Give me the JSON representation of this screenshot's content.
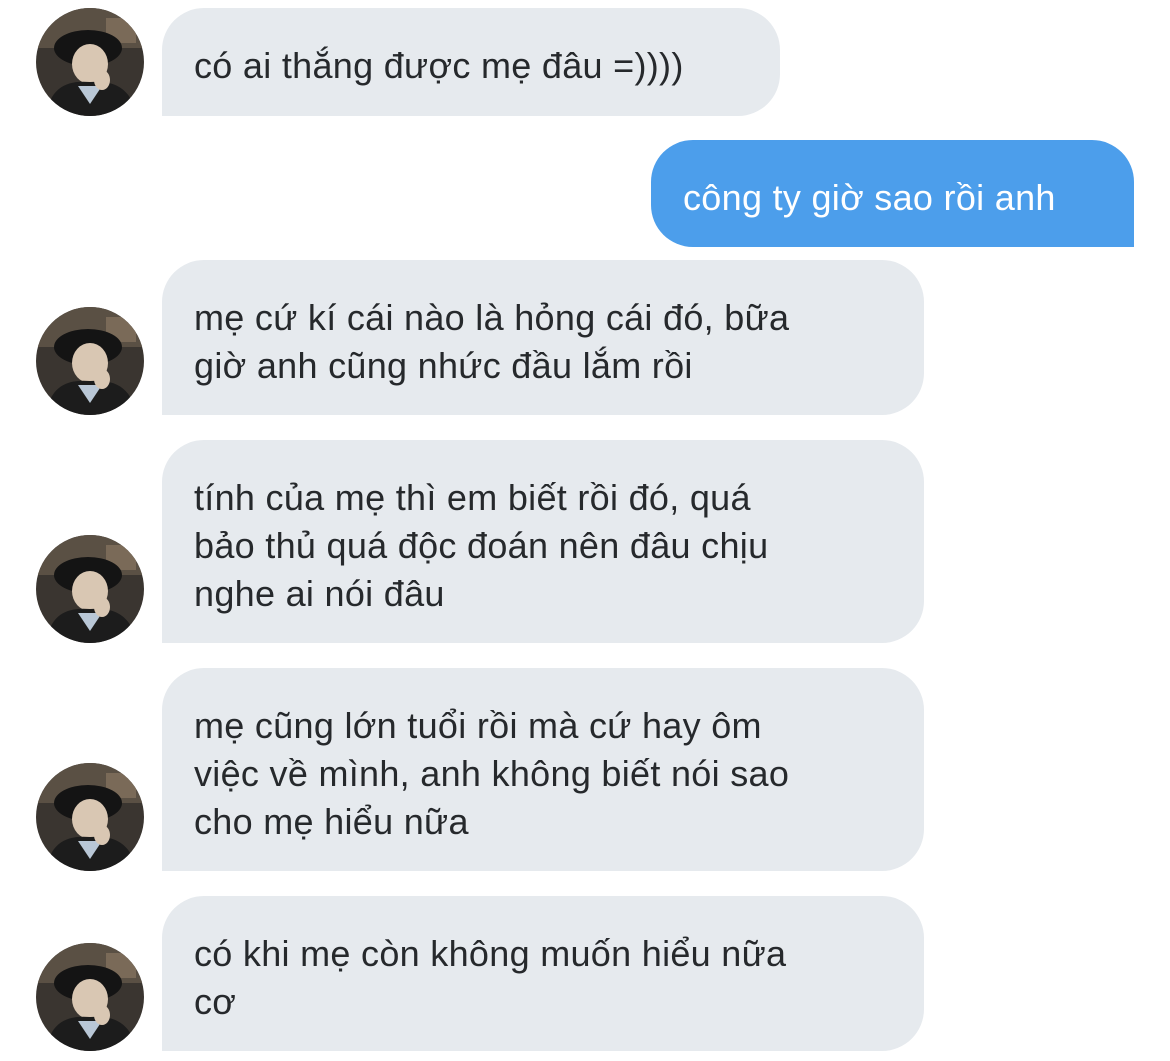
{
  "colors": {
    "incoming_bubble": "#e6eaee",
    "outgoing_bubble": "#4c9eeb",
    "incoming_text": "#26292c",
    "outgoing_text": "#ffffff"
  },
  "messages": [
    {
      "direction": "incoming",
      "text": "có ai thắng được mẹ đâu =))))"
    },
    {
      "direction": "outgoing",
      "text": "công ty giờ sao rồi anh"
    },
    {
      "direction": "incoming",
      "text": "mẹ cứ kí cái nào là hỏng cái đó, bữa\ngiờ anh cũng nhức đầu lắm rồi"
    },
    {
      "direction": "incoming",
      "text": "tính của mẹ thì em biết rồi đó, quá\nbảo thủ quá độc đoán nên đâu chịu\nnghe ai nói đâu"
    },
    {
      "direction": "incoming",
      "text": "mẹ cũng lớn tuổi rồi mà cứ hay ôm\nviệc về mình, anh không biết nói sao\ncho mẹ hiểu nữa"
    },
    {
      "direction": "incoming",
      "text": "có khi mẹ còn không muốn hiểu nữa\ncơ"
    }
  ],
  "avatar": {
    "icon": "profile-photo-avatar"
  }
}
